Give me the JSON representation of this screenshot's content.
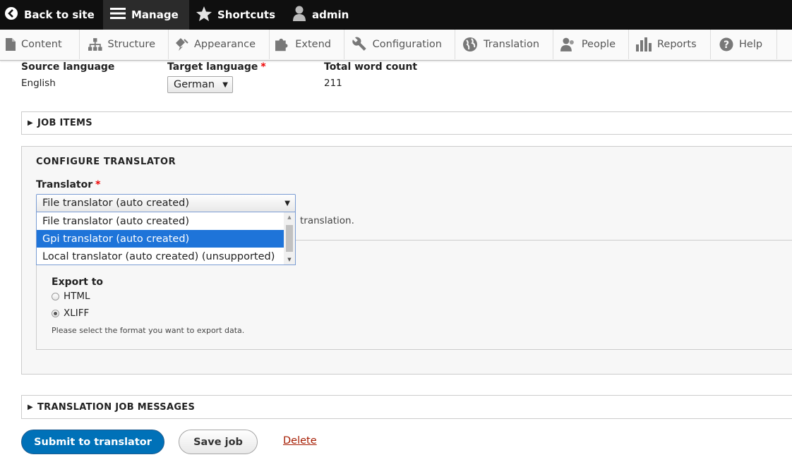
{
  "toolbar": {
    "back": "Back to site",
    "manage": "Manage",
    "shortcuts": "Shortcuts",
    "user": "admin"
  },
  "tray": [
    "Content",
    "Structure",
    "Appearance",
    "Extend",
    "Configuration",
    "Translation",
    "People",
    "Reports",
    "Help"
  ],
  "summary": {
    "source_label": "Source language",
    "source_value": "English",
    "target_label": "Target language",
    "target_value": "German",
    "count_label": "Total word count",
    "count_value": "211"
  },
  "job_items": "JOB ITEMS",
  "configure": {
    "heading": "CONFIGURE TRANSLATOR",
    "translator_label": "Translator",
    "selected": "File translator (auto created)",
    "options": [
      "File translator (auto created)",
      "Gpi translator (auto created)",
      "Local translator (auto created) (unsupported)"
    ],
    "highlighted_index": 1,
    "description_tail": "translation.",
    "export_label": "Export to",
    "export_options": [
      "HTML",
      "XLIFF"
    ],
    "export_selected": "XLIFF",
    "export_help": "Please select the format you want to export data."
  },
  "messages": "TRANSLATION JOB MESSAGES",
  "actions": {
    "submit": "Submit to translator",
    "save": "Save job",
    "delete": "Delete"
  },
  "colors": {
    "accent": "#0071b8",
    "danger": "#a51b00",
    "highlight": "#1e74d9"
  }
}
